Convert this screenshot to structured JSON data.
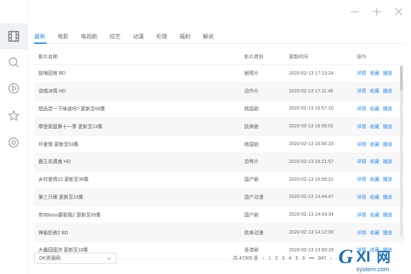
{
  "window": {
    "minimize_icon": "minus-icon",
    "maximize_icon": "plus-icon",
    "close_icon": "close-icon"
  },
  "sidebar": {
    "items": [
      {
        "name": "film-icon",
        "active": true
      },
      {
        "name": "search-icon",
        "active": false
      },
      {
        "name": "play-icon",
        "active": false
      },
      {
        "name": "star-icon",
        "active": false
      },
      {
        "name": "gear-icon",
        "active": false
      }
    ]
  },
  "tabs": [
    "最新",
    "电影",
    "电视剧",
    "综艺",
    "动漫",
    "伦理",
    "福利",
    "解说"
  ],
  "table": {
    "headers": {
      "name": "影片名称",
      "type": "影片类别",
      "time": "更新时间",
      "ops": "操作"
    },
    "op_labels": {
      "detail": "详情",
      "fav": "收藏",
      "play": "播放"
    },
    "rows": [
      {
        "name": "前哨因官 BD",
        "type": "剧情片",
        "time": "2020-02-13 17:13:24"
      },
      {
        "name": "说唱冰情 HD",
        "type": "动作片",
        "time": "2020-02-13 17:11:46"
      },
      {
        "name": "想品尝一下味道吗? 更新至68集",
        "type": "韩国剧",
        "time": "2020-02-13 16:57:10"
      },
      {
        "name": "摩登家庭第十一季 更新至13集",
        "type": "欧美剧",
        "time": "2020-02-13 16:56:01"
      },
      {
        "name": "坏爱情 更新至53集",
        "type": "韩国剧",
        "time": "2020-02-13 16:54:23"
      },
      {
        "name": "霸王花遇鬼 HD",
        "type": "恐怖片",
        "time": "2020-02-13 16:21:57"
      },
      {
        "name": "乡村爱情12 更新至36集",
        "type": "国产剧",
        "time": "2020-02-13 16:08:21"
      },
      {
        "name": "第三只眼 更新至23集",
        "type": "国产动漫",
        "time": "2020-02-13 14:44:47"
      },
      {
        "name": "奈何boss要娶我2 更新至05集",
        "type": "国产剧",
        "time": "2020-02-13 14:43:34"
      },
      {
        "name": "神偷奶爸2 BD",
        "type": "欧美动漫",
        "time": "2020-02-13 14:12:30"
      },
      {
        "name": "大鑫园国济 更新至18集",
        "type": "香港剧",
        "time": "2020-02-13 13:50:19"
      }
    ]
  },
  "footer": {
    "source_value": "OK资源网",
    "total": "共 47305 条",
    "prev": "‹",
    "pages": [
      "1",
      "2",
      "3",
      "4",
      "5",
      "6",
      "•••",
      "947"
    ],
    "next": "›"
  },
  "watermark": {
    "brand": "GXI网",
    "url": "system.com"
  },
  "colors": {
    "accent": "#2d8cf0",
    "row_alt": "#f7f7f7",
    "sidebar_active": "#eef2f7",
    "watermark": "#1f6fb0"
  }
}
